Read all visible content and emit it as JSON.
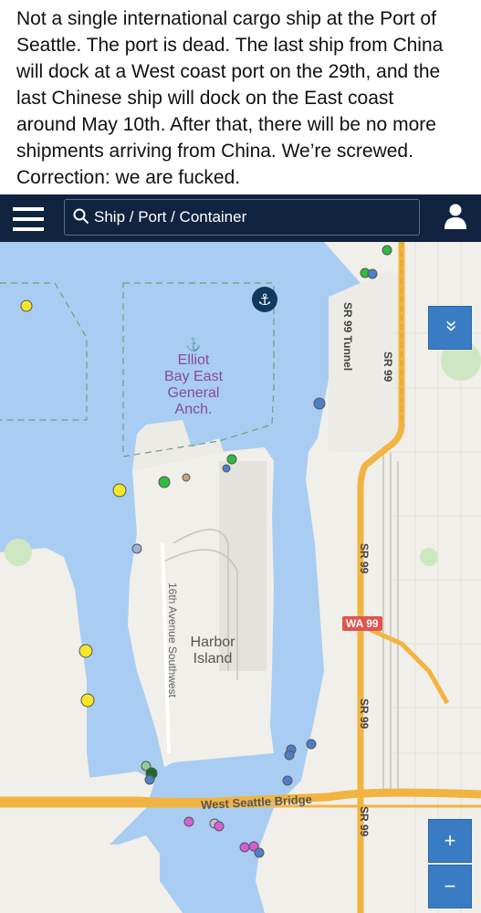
{
  "post": {
    "caption": "Not a single international cargo ship at the Port of\nSeattle. The port is dead. The last ship from China\nwill dock at a West coast port on the 29th, and the\nlast Chinese ship will dock on the East coast\naround May 10th. After that, there will be no more\nshipments arriving from China. We’re screwed.\nCorrection: we are fucked."
  },
  "app_bar": {
    "search_placeholder": "Ship / Port / Container"
  },
  "map": {
    "anchorage_label": "Elliot\nBay East\nGeneral\nAnch.",
    "island_label": "Harbor\nIsland",
    "roads": {
      "sr99_tunnel": "SR 99 Tunnel",
      "sr99_a": "SR 99",
      "sr99_b": "SR 99",
      "sr99_c": "SR 99",
      "sr99_d": "SR 99",
      "wa99": "WA 99",
      "west_seattle_bridge": "West Seattle Bridge",
      "avenue": "16th Avenue Southwest"
    },
    "controls": {
      "collapse": "«",
      "zoom_in": "+",
      "zoom_out": "−"
    },
    "colors": {
      "water": "#a9cdf2",
      "land": "#f1efe9",
      "highway": "#f2b441",
      "cargo_yellow": "#f6e629",
      "tanker_green": "#2fbb3c",
      "passenger_blue": "#4e7fc6",
      "pleasure_pink": "#d25fd6",
      "tug_tan": "#c8a27b"
    }
  }
}
